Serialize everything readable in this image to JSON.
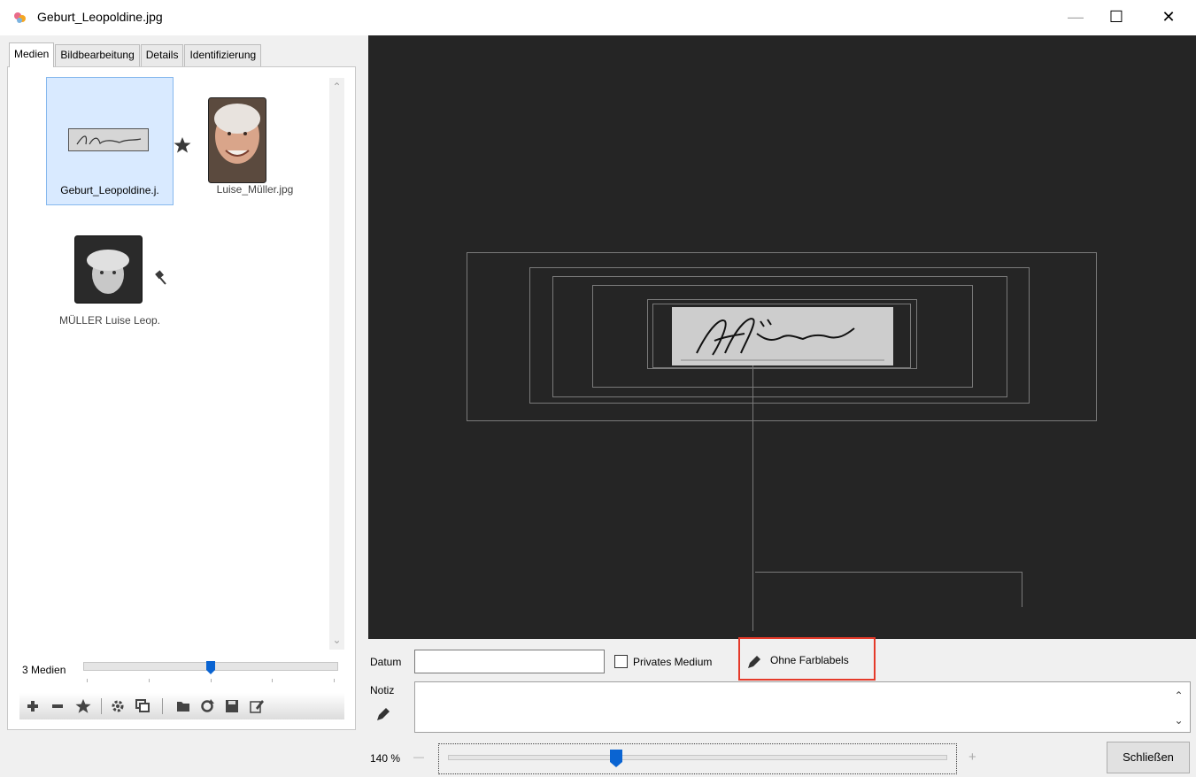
{
  "window": {
    "title": "Geburt_Leopoldine.jpg",
    "minimize_symbol": "—",
    "maximize_symbol": "☐",
    "close_symbol": "✕"
  },
  "tabs": [
    "Medien",
    "Bildbearbeitung",
    "Details",
    "Identifizierung"
  ],
  "active_tab": "Medien",
  "media": [
    {
      "caption": "Geburt_Leopoldine.j.",
      "selected": true,
      "badge": "star-icon"
    },
    {
      "caption": "Luise_Müller.jpg",
      "selected": false
    },
    {
      "caption": "MÜLLER Luise Leop.",
      "selected": false,
      "badge": "pin-icon"
    }
  ],
  "media_count_label": "3 Medien",
  "media_slider_position": 0.5,
  "toolbar_icons": [
    "add-icon",
    "remove-icon",
    "star-icon",
    "settings-icon",
    "copy-images-icon",
    "folder-icon",
    "refresh-icon",
    "save-icon",
    "edit-icon"
  ],
  "fields": {
    "datum_label": "Datum",
    "datum_value": "",
    "private_label": "Privates Medium",
    "private_checked": false,
    "farblabel_text": "Ohne Farblabels",
    "notiz_label": "Notiz",
    "notiz_value": ""
  },
  "zoom": {
    "label": "140 %",
    "minus_symbol": "—",
    "plus_symbol": "+",
    "slider_fraction": 0.33
  },
  "close_button": "Schließen",
  "colors": {
    "viewer_bg": "#252525",
    "selection_bg": "#d9eaff",
    "slider_knob": "#0a64d2",
    "highlight_box": "#e53a2a"
  }
}
